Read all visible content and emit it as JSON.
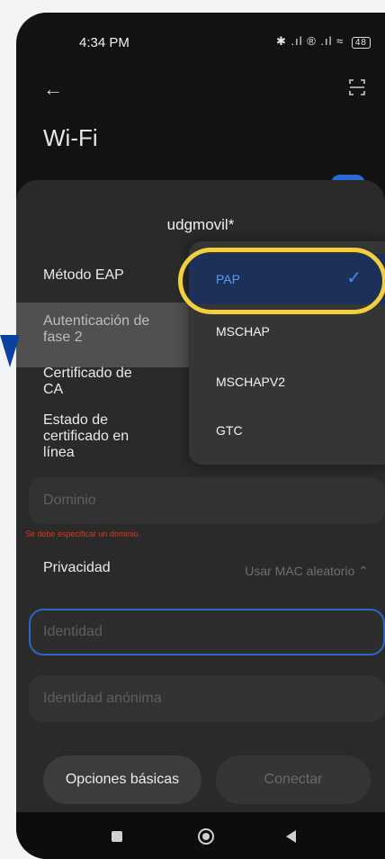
{
  "status": {
    "time": "4:34 PM",
    "icons": "✱ .ıl ® .ıl ≈",
    "battery": "48"
  },
  "header": {
    "title": "Wi-Fi"
  },
  "dialog": {
    "network_name": "udgmovil*",
    "rows": [
      {
        "label": "Método EAP"
      },
      {
        "label": "Autenticación de fase 2"
      },
      {
        "label": "Certificado de CA"
      },
      {
        "label": "Estado de certificado en línea"
      }
    ],
    "domain": {
      "placeholder": "Dominio",
      "error": "Se debe especificar un dominio."
    },
    "privacy": {
      "label": "Privacidad",
      "value": "Usar MAC aleatorio"
    },
    "identity": {
      "placeholder": "Identidad"
    },
    "anonymous_identity": {
      "placeholder": "Identidad anónima"
    },
    "buttons": {
      "basic": "Opciones básicas",
      "connect": "Conectar"
    }
  },
  "dropdown": {
    "options": [
      {
        "label": "PAP",
        "selected": true
      },
      {
        "label": "MSCHAP",
        "selected": false
      },
      {
        "label": "MSCHAPV2",
        "selected": false
      },
      {
        "label": "GTC",
        "selected": false
      }
    ],
    "check_icon": "✓"
  },
  "colors": {
    "accent": "#3d8bff",
    "highlight_ring": "#f2cf3c",
    "error": "#e0341f",
    "pointer": "#0b3fa0"
  }
}
